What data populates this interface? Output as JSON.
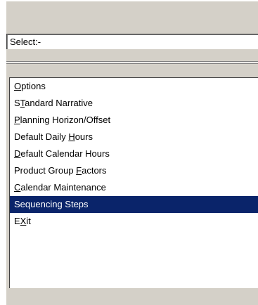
{
  "select": {
    "value": "Select:-"
  },
  "menu": {
    "items": [
      {
        "pre": "",
        "key": "O",
        "post": "ptions",
        "selected": false
      },
      {
        "pre": "S",
        "key": "T",
        "post": "andard Narrative",
        "selected": false
      },
      {
        "pre": "",
        "key": "P",
        "post": "lanning Horizon/Offset",
        "selected": false
      },
      {
        "pre": "Default Daily ",
        "key": "H",
        "post": "ours",
        "selected": false
      },
      {
        "pre": "",
        "key": "D",
        "post": "efault Calendar Hours",
        "selected": false
      },
      {
        "pre": "Product Group ",
        "key": "F",
        "post": "actors",
        "selected": false
      },
      {
        "pre": "",
        "key": "C",
        "post": "alendar Maintenance",
        "selected": false
      },
      {
        "pre": "Sequencing Steps",
        "key": "",
        "post": "",
        "selected": true
      },
      {
        "pre": "E",
        "key": "X",
        "post": "it",
        "selected": false
      }
    ]
  },
  "colors": {
    "selection_background": "#0a246a",
    "selection_text": "#ffffff",
    "panel_background": "#d4d0c8"
  }
}
